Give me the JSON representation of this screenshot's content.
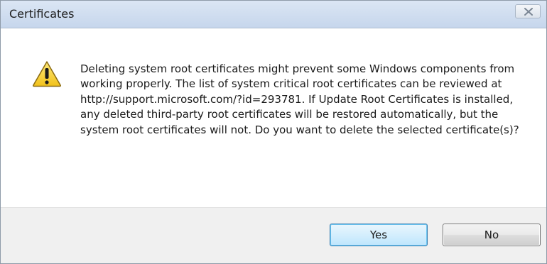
{
  "window": {
    "title": "Certificates"
  },
  "icons": {
    "warning": "warning-icon",
    "close": "close-icon"
  },
  "dialog": {
    "message": "Deleting system root certificates might prevent some Windows components from working properly. The list of system critical root certificates can be reviewed at http://support.microsoft.com/?id=293781. If Update Root Certificates is installed, any deleted third-party root certificates will be restored automatically, but the system root certificates will not. Do you want to delete the selected certificate(s)?"
  },
  "buttons": {
    "yes_label": "Yes",
    "no_label": "No"
  },
  "colors": {
    "warning_fill": "#f7d23a",
    "warning_border": "#8a6a10",
    "default_button_border": "#3c7fb1"
  }
}
